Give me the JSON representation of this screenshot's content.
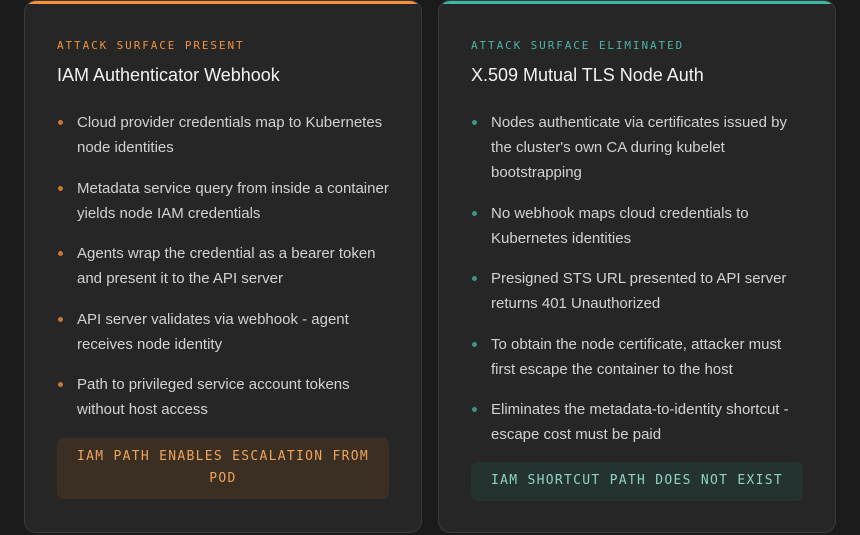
{
  "colors": {
    "present_accent": "#f5913a",
    "eliminated_accent": "#3fb5a3",
    "card_background": "#262626",
    "page_background": "#1b1b1b"
  },
  "left_card": {
    "eyebrow": "ATTACK SURFACE PRESENT",
    "title": "IAM Authenticator Webhook",
    "items": [
      "Cloud provider credentials map to Kubernetes node identities",
      "Metadata service query from inside a container yields node IAM credentials",
      "Agents wrap the credential as a bearer token and present it to the API server",
      "API server validates via webhook - agent receives node identity",
      "Path to privileged service account tokens without host access"
    ],
    "verdict": "IAM PATH ENABLES ESCALATION FROM POD"
  },
  "right_card": {
    "eyebrow": "ATTACK SURFACE ELIMINATED",
    "title": "X.509 Mutual TLS Node Auth",
    "items": [
      "Nodes authenticate via certificates issued by the cluster's own CA during kubelet bootstrapping",
      "No webhook maps cloud credentials to Kubernetes identities",
      "Presigned STS URL presented to API server returns 401 Unauthorized",
      "To obtain the node certificate, attacker must first escape the container to the host",
      "Eliminates the metadata-to-identity shortcut - escape cost must be paid"
    ],
    "verdict": "IAM SHORTCUT PATH DOES NOT EXIST"
  }
}
